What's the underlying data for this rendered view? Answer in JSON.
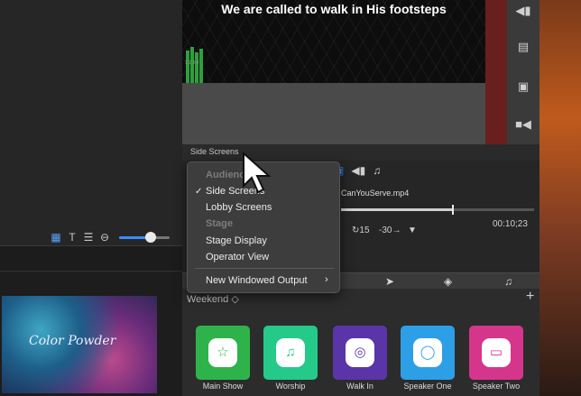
{
  "preview": {
    "lyric": "We are called to walk in His footsteps",
    "meter_numbers": "1 2 3 4"
  },
  "side_screens": {
    "label": "Side Screens"
  },
  "menu": {
    "audience_header": "Audience",
    "side_screens": "Side Screens",
    "side_screens_checked": "✓",
    "lobby_screens": "Lobby Screens",
    "stage_header": "Stage",
    "stage_display": "Stage Display",
    "operator_view": "Operator View",
    "new_windowed_output": "New Windowed Output",
    "submenu_arrow": "›"
  },
  "media": {
    "file_name": "CanYouServe.mp4",
    "timecode": "00:10;23",
    "progress": 0.58,
    "skip_forward": "15",
    "skip_back": "-30"
  },
  "view_tools": {
    "slider_value": 0.62
  },
  "thumbnail": {
    "title": "Color Powder"
  },
  "playlist": {
    "name": "Weekend ◇",
    "add": "+"
  },
  "macros": [
    {
      "label": "Main Show",
      "color": "#2eb34a",
      "icon": "☆",
      "icon_color": "#2eb34a"
    },
    {
      "label": "Worship",
      "color": "#25c98a",
      "icon": "♫",
      "icon_color": "#25c98a"
    },
    {
      "label": "Walk In",
      "color": "#5a35a8",
      "icon": "◎",
      "icon_color": "#5a35a8"
    },
    {
      "label": "Speaker One",
      "color": "#2d9fe6",
      "icon": "◯",
      "icon_color": "#2d9fe6"
    },
    {
      "label": "Speaker Two",
      "color": "#d6358c",
      "icon": "▭",
      "icon_color": "#d6358c"
    }
  ],
  "colors": {
    "accent": "#3b8bff",
    "red_strip": "#6a1f1f"
  }
}
